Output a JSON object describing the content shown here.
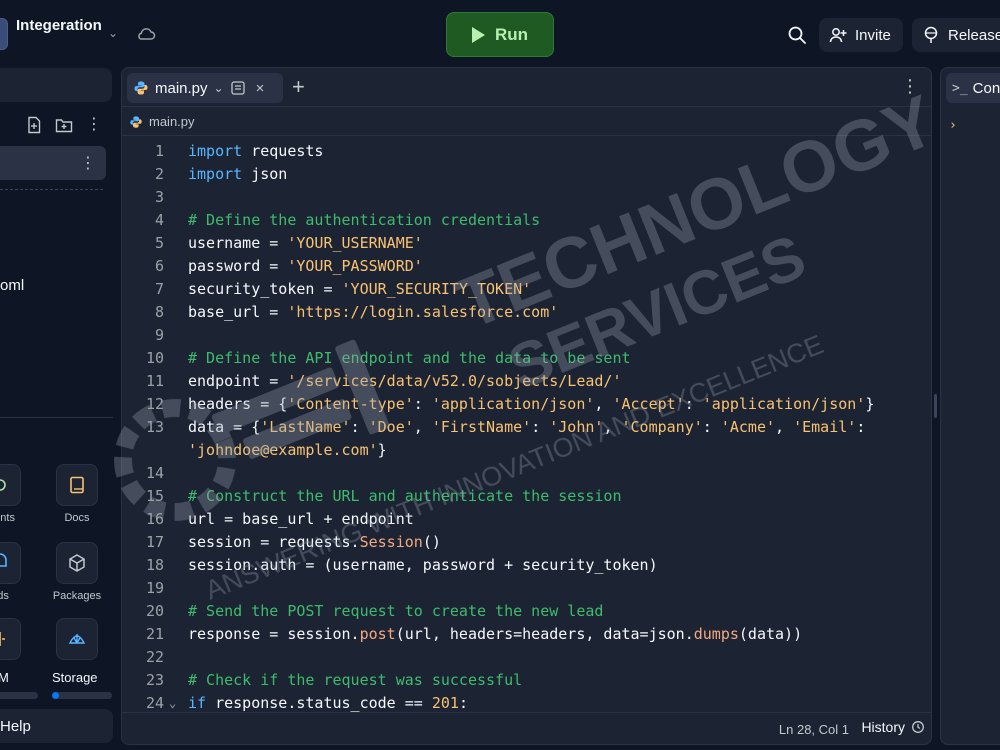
{
  "topbar": {
    "project_name": "Integeration",
    "run_label": "Run",
    "invite_label": "Invite",
    "release_label": "Release"
  },
  "sidebar": {
    "visible_file": "oml",
    "tools": [
      {
        "label": "ments",
        "icon": "secrets-icon"
      },
      {
        "label": "Docs",
        "icon": "docs-icon"
      },
      {
        "label": "ads",
        "icon": "threads-icon"
      },
      {
        "label": "Packages",
        "icon": "package-icon"
      },
      {
        "label": "",
        "icon": "split-icon"
      },
      {
        "label": "",
        "icon": "storage-shell-icon"
      }
    ],
    "meters": [
      {
        "label": "M",
        "fill_fraction": 0.0
      },
      {
        "label": "Storage",
        "fill_fraction": 0.12
      }
    ],
    "help_label": "Help"
  },
  "editor": {
    "tab_name": "main.py",
    "breadcrumb": "main.py",
    "lines": [
      {
        "n": "1",
        "html": "<span class=\"tk-kw\">import</span> requests"
      },
      {
        "n": "2",
        "html": "<span class=\"tk-kw\">import</span> json"
      },
      {
        "n": "3",
        "html": ""
      },
      {
        "n": "4",
        "html": "<span class=\"tk-cm\"># Define the authentication credentials</span>"
      },
      {
        "n": "5",
        "html": "username = <span class=\"tk-str\">'YOUR_USERNAME'</span>"
      },
      {
        "n": "6",
        "html": "password = <span class=\"tk-str\">'YOUR_PASSWORD'</span>"
      },
      {
        "n": "7",
        "html": "security_token = <span class=\"tk-str\">'YOUR_SECURITY_TOKEN'</span>"
      },
      {
        "n": "8",
        "html": "base_url = <span class=\"tk-str\">'https://login.salesforce.com'</span>"
      },
      {
        "n": "9",
        "html": ""
      },
      {
        "n": "10",
        "html": "<span class=\"tk-cm\"># Define the API endpoint and the data to be sent</span>"
      },
      {
        "n": "11",
        "html": "endpoint = <span class=\"tk-str\">'/services/data/v52.0/sobjects/Lead/'</span>"
      },
      {
        "n": "12",
        "html": "headers = {<span class=\"tk-str\">'Content-type'</span>: <span class=\"tk-str\">'application/json'</span>, <span class=\"tk-str\">'Accept'</span>: <span class=\"tk-str\">'application/json'</span>}"
      },
      {
        "n": "13",
        "html": "data = {<span class=\"tk-str\">'LastName'</span>: <span class=\"tk-str\">'Doe'</span>, <span class=\"tk-str\">'FirstName'</span>: <span class=\"tk-str\">'John'</span>, <span class=\"tk-str\">'Company'</span>: <span class=\"tk-str\">'Acme'</span>, <span class=\"tk-str\">'Email'</span>:"
      },
      {
        "n": "",
        "html": "<span class=\"tk-str\">'johndoe@example.com'</span>}"
      },
      {
        "n": "14",
        "html": ""
      },
      {
        "n": "15",
        "html": "<span class=\"tk-cm\"># Construct the URL and authenticate the session</span>"
      },
      {
        "n": "16",
        "html": "url = base_url + endpoint"
      },
      {
        "n": "17",
        "html": "session = requests.<span class=\"tk-fn\">Session</span>()"
      },
      {
        "n": "18",
        "html": "session.auth = (username, password + security_token)"
      },
      {
        "n": "19",
        "html": ""
      },
      {
        "n": "20",
        "html": "<span class=\"tk-cm\"># Send the POST request to create the new lead</span>"
      },
      {
        "n": "21",
        "html": "response = session.<span class=\"tk-fn\">post</span>(url, headers=headers, data=json.<span class=\"tk-fn\">dumps</span>(data))"
      },
      {
        "n": "22",
        "html": ""
      },
      {
        "n": "23",
        "html": "<span class=\"tk-cm\"># Check if the request was successful</span>"
      },
      {
        "n": "24",
        "html": "<span class=\"tk-kw\">if</span> response.status_code == <span class=\"tk-num\">201</span>:",
        "fold": true
      }
    ],
    "status_position": "Ln 28, Col 1",
    "history_label": "History"
  },
  "console": {
    "tab_label": "Cons",
    "prompt": "›"
  },
  "watermark": {
    "line1": "TECHNOLOGY",
    "line2": "SERVICES",
    "tagline": "ANSWERING WITH INNOVATION AND EXCELLENCE"
  },
  "colors": {
    "background": "#0e1525",
    "panel": "#1c2333",
    "run_green": "#1f5a23",
    "keyword": "#56b6ff",
    "string": "#f9c270",
    "comment": "#3dbd6c"
  }
}
